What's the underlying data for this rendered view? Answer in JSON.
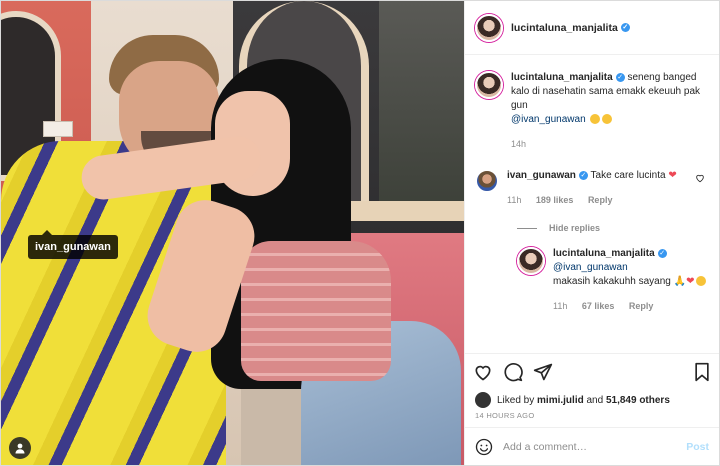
{
  "photo": {
    "tag_username": "ivan_gunawan"
  },
  "header": {
    "username": "lucintaluna_manjalita",
    "verified": true
  },
  "caption": {
    "username": "lucintaluna_manjalita",
    "text": "seneng banged kalo di nasehatin sama emakk ekeuuh pak gun",
    "mention": "@ivan_gunawan",
    "time": "14h"
  },
  "comments": [
    {
      "username": "ivan_gunawan",
      "text": "Take care lucinta",
      "time": "11h",
      "likes": "189 likes",
      "reply_label": "Reply"
    }
  ],
  "hide_replies_label": "Hide replies",
  "reply": {
    "username": "lucintaluna_manjalita",
    "mention": "@ivan_gunawan",
    "text": "makasih kakakuhh sayang",
    "time": "11h",
    "likes": "67 likes",
    "reply_label": "Reply"
  },
  "likes_bar": {
    "prefix": "Liked by",
    "user": "mimi.julid",
    "joiner": "and",
    "others": "51,849 others"
  },
  "timestamp": "14 HOURS AGO",
  "add_comment": {
    "placeholder": "Add a comment…",
    "post_label": "Post"
  },
  "colors": {
    "link": "#00376b",
    "verified": "#3897f0",
    "post_button": "#b2dffc"
  }
}
